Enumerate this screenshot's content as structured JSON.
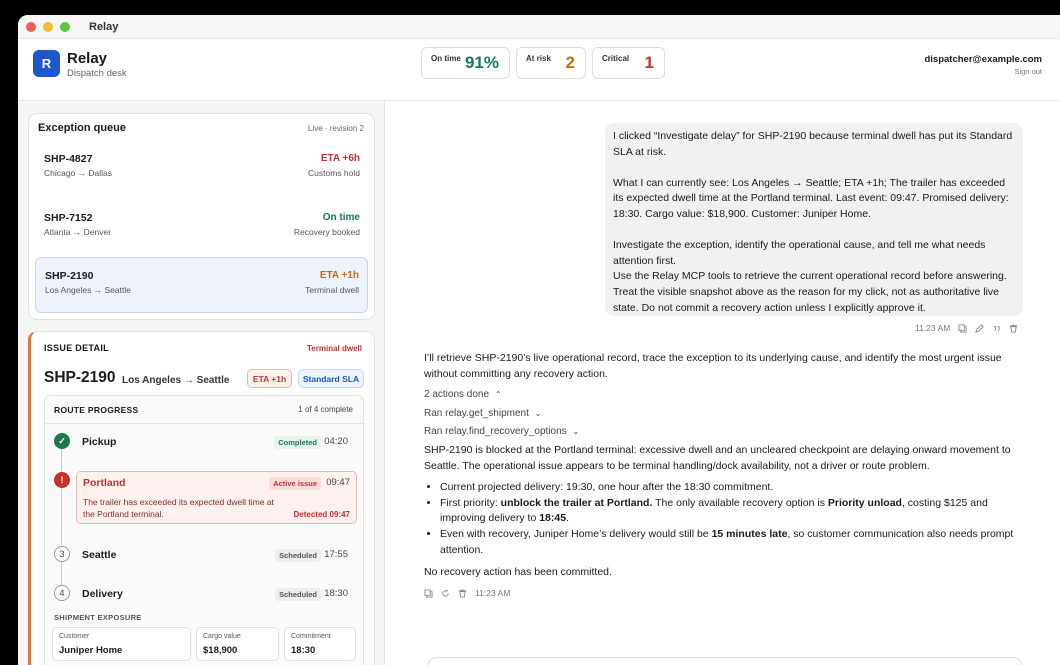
{
  "app": {
    "window_title": "Relay"
  },
  "header": {
    "brand": "Relay",
    "brand_initial": "R",
    "subtitle": "Dispatch desk",
    "stats": [
      {
        "label": "On time",
        "value": "91%",
        "color": "#1a7a4c"
      },
      {
        "label": "At risk",
        "value": "2",
        "color": "#c96a12"
      },
      {
        "label": "Critical",
        "value": "1",
        "color": "#c9302c"
      }
    ],
    "user_email": "dispatcher@example.com",
    "sign_out": "Sign out"
  },
  "queue": {
    "title": "Exception queue",
    "live": "Live · revision 2",
    "items": [
      {
        "id": "SHP-4827",
        "route": "Chicago → Dallas",
        "eta": "ETA +6h",
        "reason": "Customs hold",
        "color": "#c9302c"
      },
      {
        "id": "SHP-7152",
        "route": "Atlanta → Denver",
        "eta": "On time",
        "reason": "Recovery booked",
        "color": "#1a7a4c"
      },
      {
        "id": "SHP-2190",
        "route": "Los Angeles → Seattle",
        "eta": "ETA +1h",
        "reason": "Terminal dwell",
        "color": "#c96a12"
      }
    ]
  },
  "detail": {
    "label": "ISSUE DETAIL",
    "tag": "Terminal dwell",
    "shipment_id": "SHP-2190",
    "route": "Los Angeles → Seattle",
    "eta_pill": "ETA +1h",
    "sla_pill": "Standard SLA",
    "progress_title": "ROUTE PROGRESS",
    "progress_count": "1 of 4 complete",
    "stops": [
      {
        "name": "Pickup",
        "status": "Completed",
        "time": "04:20",
        "marker": "✓"
      },
      {
        "name": "Portland",
        "status": "Active issue",
        "time": "09:47",
        "marker": "!"
      },
      {
        "name": "Seattle",
        "status": "Scheduled",
        "time": "17:55",
        "marker": "3"
      },
      {
        "name": "Delivery",
        "status": "Scheduled",
        "time": "18:30",
        "marker": "4"
      }
    ],
    "issue_text": "The trailer has exceeded its expected dwell time at the Portland terminal.",
    "issue_detected": "Detected 09:47",
    "exposure_title": "SHIPMENT EXPOSURE",
    "exposure": [
      {
        "label": "Customer",
        "value": "Juniper Home"
      },
      {
        "label": "Cargo value",
        "value": "$18,900"
      },
      {
        "label": "Commitment",
        "value": "18:30"
      }
    ]
  },
  "chat": {
    "user_paragraphs": [
      "I clicked “Investigate delay” for SHP-2190 because terminal dwell has put its Standard SLA at risk.",
      "What I can currently see: Los Angeles → Seattle; ETA +1h; The trailer has exceeded its expected dwell time at the Portland terminal. Last event: 09:47. Promised delivery: 18:30. Cargo value: $18,900. Customer: Juniper Home.",
      "Investigate the exception, identify the operational cause, and tell me what needs attention first.",
      "Use the Relay MCP tools to retrieve the current operational record before answering.",
      "Treat the visible snapshot above as the reason for my click, not as authoritative live state. Do not commit a recovery action unless I explicitly approve it."
    ],
    "user_time": "11:23 AM",
    "reply_intro": "I’ll retrieve SHP-2190’s live operational record, trace the exception to its underlying cause, and identify the most urgent issue without committing any recovery action.",
    "actions_done": "2 actions done",
    "action_1": "Ran relay.get_shipment",
    "action_2": "Ran relay.find_recovery_options",
    "finding": "SHP-2190 is blocked at the Portland terminal: excessive dwell and an uncleared checkpoint are delaying onward movement to Seattle. The operational issue appears to be terminal handling/dock availability, not a driver or route problem.",
    "bullet_1": "Current projected delivery: 19:30, one hour after the 18:30 commitment.",
    "bullet_2_a": "First priority: ",
    "bullet_2_b": "unblock the trailer at Portland.",
    "bullet_2_c": " The only available recovery option is ",
    "bullet_2_d": "Priority unload",
    "bullet_2_e": ", costing $125 and improving delivery to ",
    "bullet_2_f": "18:45",
    "bullet_2_g": ".",
    "bullet_3_a": "Even with recovery, Juniper Home’s delivery would still be ",
    "bullet_3_b": "15 minutes late",
    "bullet_3_c": ", so customer communication also needs prompt attention.",
    "closing": "No recovery action has been committed.",
    "reply_time": "11:23 AM"
  }
}
